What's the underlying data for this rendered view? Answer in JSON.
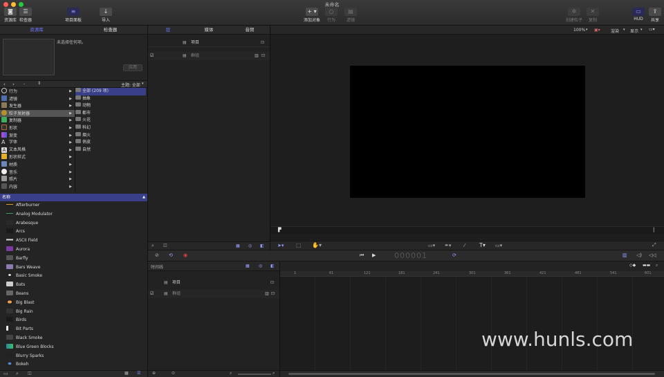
{
  "window": {
    "title": "未命名"
  },
  "toolbar": {
    "library": "资源库",
    "inspector": "检查器",
    "project_panel": "项目面板",
    "import": "导入",
    "add_object": "添加对象",
    "behaviors": "行为",
    "filters": "滤镜",
    "make_particles": "创建粒子",
    "replicate": "复制",
    "hud": "HUD",
    "share": "共享"
  },
  "left_tabs": [
    "资源库",
    "检查器"
  ],
  "preview": {
    "none_selected": "未选择任何项。",
    "apply": "应用"
  },
  "theme": {
    "label": "主题: 全部"
  },
  "categories": [
    "行为",
    "滤镜",
    "发生器",
    "粒子发射器",
    "复制器",
    "形状",
    "渐变",
    "字体",
    "文本风格",
    "形状样式",
    "材质",
    "音乐",
    "照片",
    "内容"
  ],
  "subcategories": [
    "全部 (209 项)",
    "抽象",
    "动物",
    "都市",
    "火花",
    "科幻",
    "烟火",
    "俏皮",
    "自然"
  ],
  "name_header": "名称",
  "items": [
    "Afterburner",
    "Analog Modulator",
    "Arabesque",
    "Arcs",
    "ASCII Field",
    "Aurora",
    "Barfly",
    "Bars Weave",
    "Basic Smoke",
    "Bats",
    "Beans",
    "Big Blast",
    "Big Rain",
    "Birds",
    "Bit Parts",
    "Black Smoke",
    "Blue Green Blocks",
    "Blurry Sparks",
    "Bokeh"
  ],
  "layers_tabs": [
    "层",
    "媒体",
    "音频"
  ],
  "layers": {
    "project": "项目",
    "group": "群组"
  },
  "canvas": {
    "zoom": "100%",
    "render": "渲染",
    "view": "显示"
  },
  "timeline": {
    "label": "时间线",
    "timecode": "000001",
    "project": "项目",
    "group": "群组"
  },
  "ruler": [
    "1",
    "61",
    "121",
    "181",
    "241",
    "301",
    "361",
    "421",
    "481",
    "541",
    "601"
  ],
  "watermark": "www.hunls.com",
  "colors": {
    "accent": "#6e78ff",
    "selected_row": "#3a3f8a",
    "black_canvas": "#000000"
  }
}
